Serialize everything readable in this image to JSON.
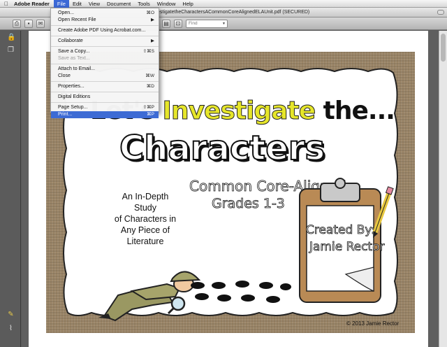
{
  "menubar": {
    "app_name": "Adobe Reader",
    "menus": [
      "File",
      "Edit",
      "View",
      "Document",
      "Tools",
      "Window",
      "Help"
    ],
    "active_menu": "File"
  },
  "window": {
    "title": "estigatetheCharactersACommonCoreAlignedELAUnit.pdf (SECURED)"
  },
  "toolbar": {
    "find_placeholder": "Find"
  },
  "file_menu": {
    "groups": [
      [
        {
          "label": "Open...",
          "shortcut": "⌘O",
          "state": "normal"
        },
        {
          "label": "Open Recent File",
          "shortcut": "▶",
          "state": "normal"
        }
      ],
      [
        {
          "label": "Create Adobe PDF Using Acrobat.com...",
          "shortcut": "",
          "state": "normal"
        }
      ],
      [
        {
          "label": "Collaborate",
          "shortcut": "▶",
          "state": "normal"
        }
      ],
      [
        {
          "label": "Save a Copy...",
          "shortcut": "⇧⌘S",
          "state": "normal"
        },
        {
          "label": "Save as Text...",
          "shortcut": "",
          "state": "disabled"
        }
      ],
      [
        {
          "label": "Attach to Email...",
          "shortcut": "",
          "state": "normal"
        },
        {
          "label": "Close",
          "shortcut": "⌘W",
          "state": "normal"
        }
      ],
      [
        {
          "label": "Properties...",
          "shortcut": "⌘D",
          "state": "normal"
        }
      ],
      [
        {
          "label": "Digital Editions",
          "shortcut": "",
          "state": "normal"
        }
      ],
      [
        {
          "label": "Page Setup...",
          "shortcut": "⇧⌘P",
          "state": "normal"
        },
        {
          "label": "Print...",
          "shortcut": "⌘P",
          "state": "highlighted"
        }
      ]
    ]
  },
  "document": {
    "title_line1_pre": "Let's ",
    "title_line1_hl": "Investigate",
    "title_line1_post": " the...",
    "title_main": "Characters",
    "subtitle": "Common Core-Aligned",
    "grades": "Grades 1-3",
    "study_lines": [
      "An In-Depth",
      "Study",
      "of Characters in",
      "Any Piece of",
      "Literature"
    ],
    "created_by": "Created By:",
    "author": "Jamie Rector",
    "copyright": "© 2013 Jamie Rector"
  }
}
